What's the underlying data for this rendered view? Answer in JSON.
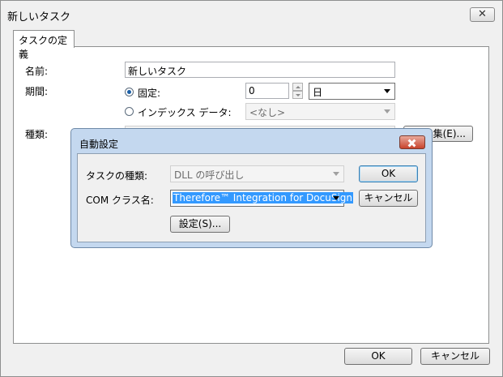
{
  "window": {
    "title": "新しいタスク",
    "close_glyph": "✕"
  },
  "tab": {
    "label": "タスクの定義"
  },
  "form": {
    "name_label": "名前:",
    "name_value": "新しいタスク",
    "period_label": "期間:",
    "fixed_label": "固定:",
    "fixed_value": "0",
    "unit_value": "日",
    "index_label": "インデックス データ:",
    "index_value": "<なし>",
    "type_label": "種類:",
    "edit_button": "集(E)..."
  },
  "dialog": {
    "title": "自動設定",
    "task_type_label": "タスクの種類:",
    "task_type_value": "DLL の呼び出し",
    "com_class_label": "COM クラス名:",
    "com_class_value": "Therefore™ Integration for DocuSign",
    "ok_button": "OK",
    "cancel_button": "キャンセル",
    "settings_button": "設定(S)..."
  },
  "footer": {
    "ok_button": "OK",
    "cancel_button": "キャンセル"
  }
}
